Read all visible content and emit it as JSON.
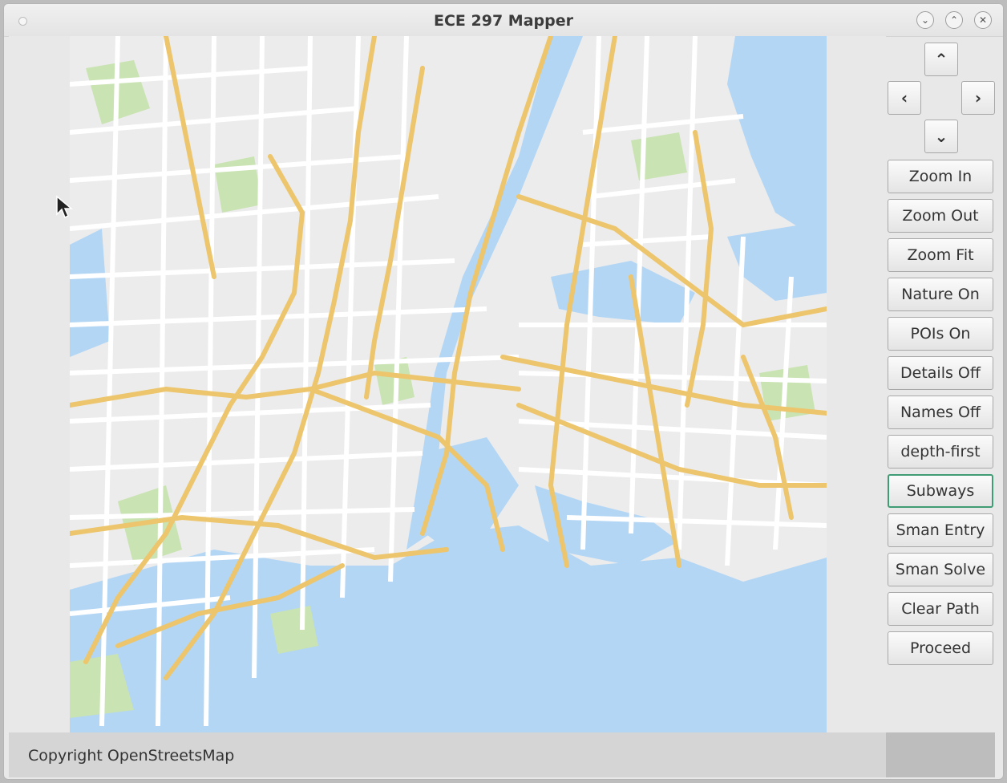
{
  "window": {
    "title": "ECE 297 Mapper"
  },
  "window_controls": {
    "minimize_glyph": "⌄",
    "maximize_glyph": "⌃",
    "close_glyph": "✕"
  },
  "nav": {
    "up_glyph": "⌃",
    "left_glyph": "‹",
    "right_glyph": "›",
    "down_glyph": "⌄"
  },
  "sidebar": {
    "buttons": [
      {
        "label": "Zoom In"
      },
      {
        "label": "Zoom Out"
      },
      {
        "label": "Zoom Fit"
      },
      {
        "label": "Nature On"
      },
      {
        "label": "POIs On"
      },
      {
        "label": "Details Off"
      },
      {
        "label": "Names Off"
      },
      {
        "label": "depth-first"
      },
      {
        "label": "Subways",
        "active": true
      },
      {
        "label": "Sman Entry"
      },
      {
        "label": "Sman Solve"
      },
      {
        "label": "Clear Path"
      },
      {
        "label": "Proceed"
      }
    ]
  },
  "status": {
    "text": "Copyright OpenStreetsMap"
  },
  "colors": {
    "water": "#b3d6f5",
    "land": "#ececec",
    "park": "#c9e3b2",
    "street": "#ffffff",
    "highway": "#ecc56c",
    "active_border": "#3f9c74"
  },
  "icons": [
    "cursor-icon",
    "chevron-up-icon",
    "chevron-down-icon",
    "chevron-left-icon",
    "chevron-right-icon",
    "close-icon"
  ]
}
